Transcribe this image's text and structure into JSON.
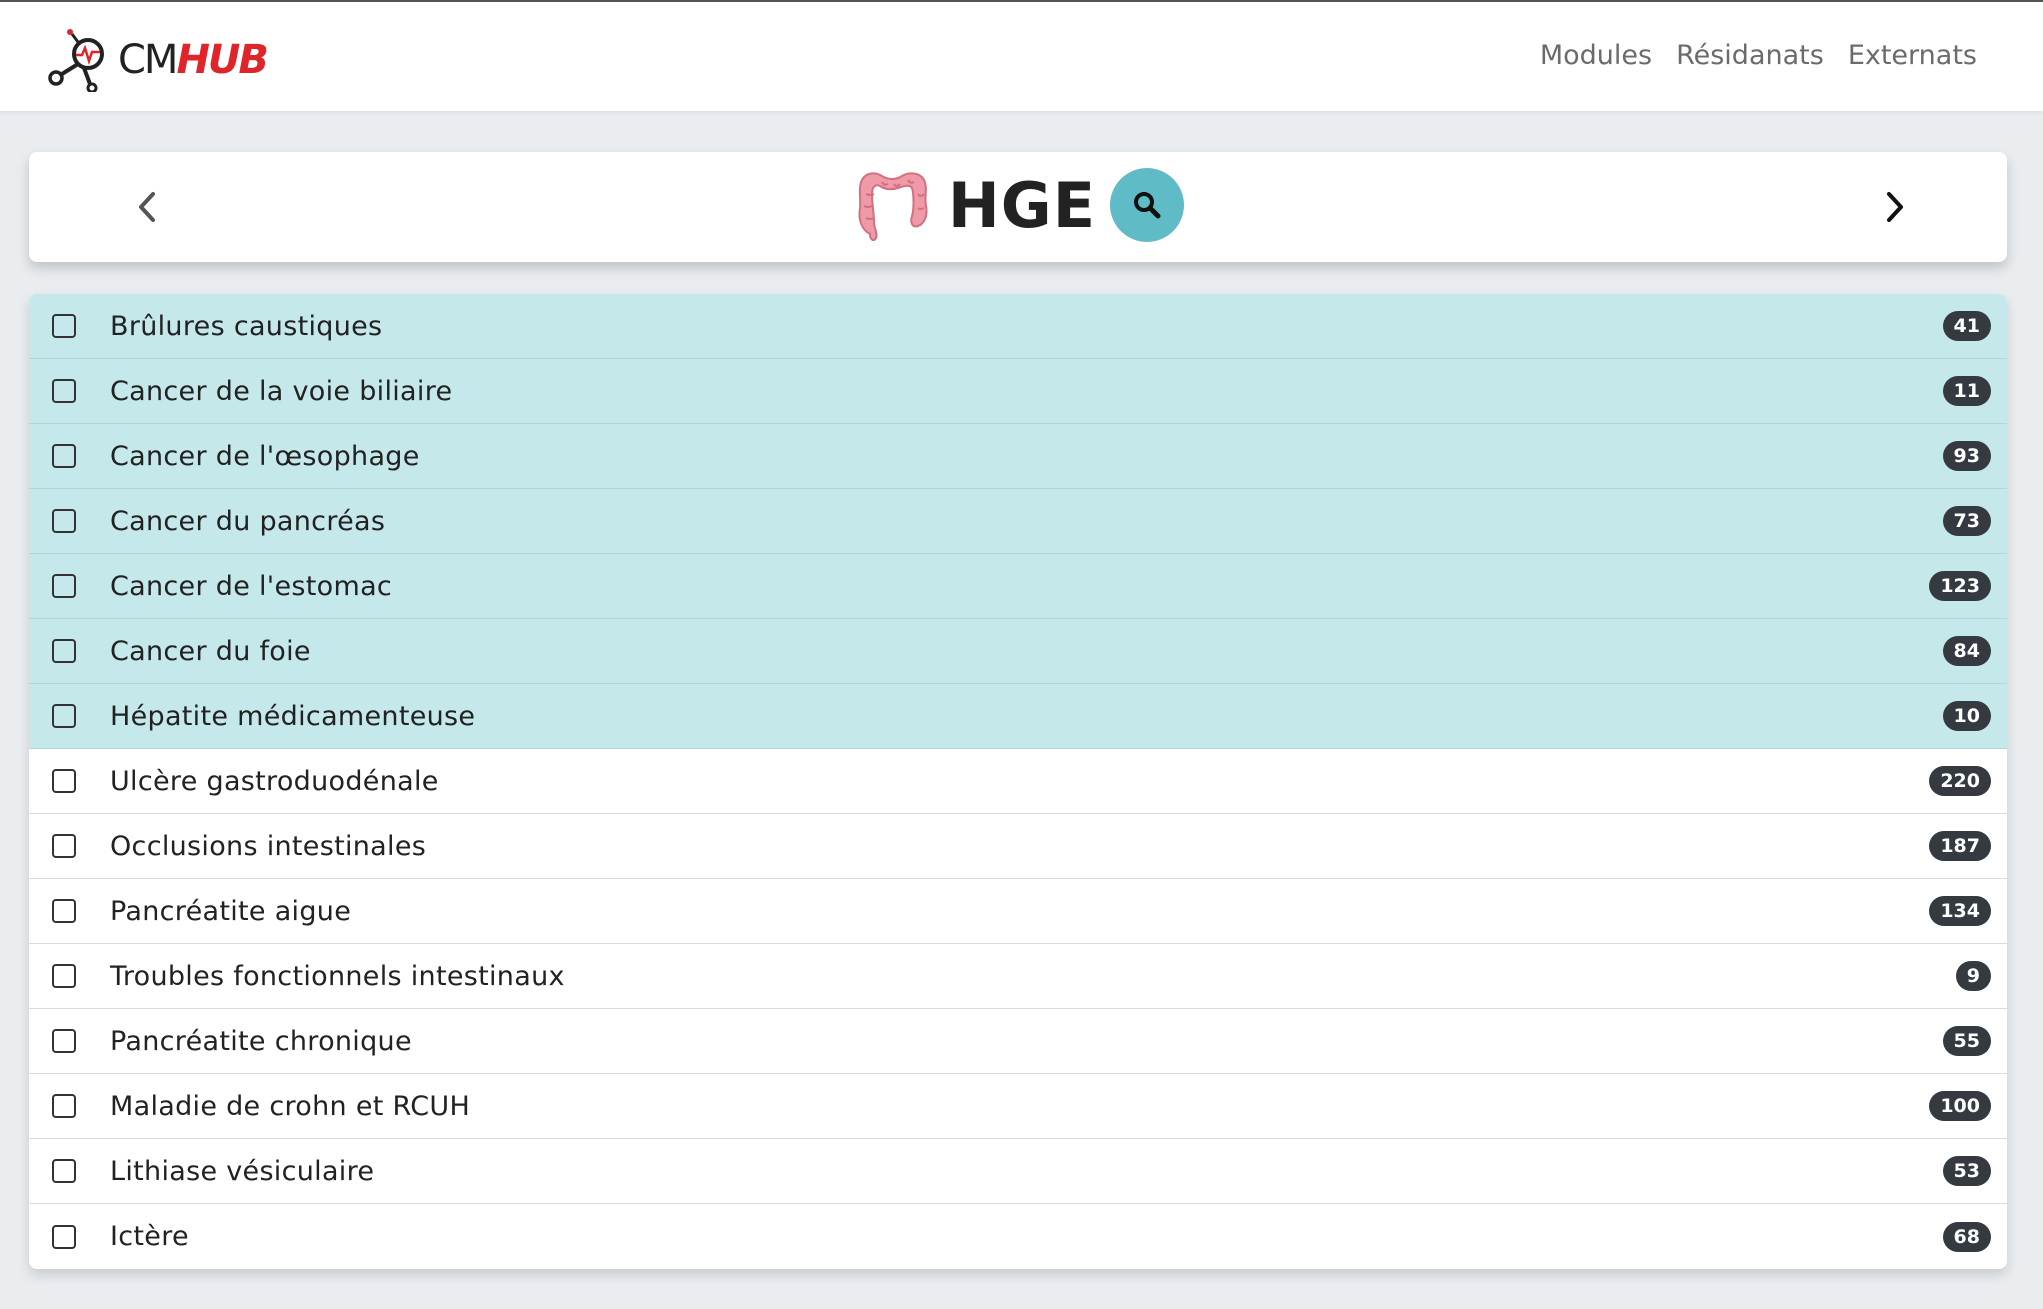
{
  "navbar": {
    "logo_cm": "CM",
    "logo_hub": "HUB",
    "links": [
      "Modules",
      "Résidanats",
      "Externats"
    ]
  },
  "header": {
    "title": "HGE",
    "prev_icon": "chevron-left-icon",
    "next_icon": "chevron-right-icon",
    "search_icon": "search-icon",
    "module_icon": "colon-icon"
  },
  "colors": {
    "accent": "#5fbcc6",
    "highlight_row": "#c5e8ea",
    "badge": "#343a40",
    "brand_red": "#e0252a"
  },
  "items": [
    {
      "label": "Brûlures caustiques",
      "count": "41",
      "highlighted": true
    },
    {
      "label": "Cancer de la voie biliaire",
      "count": "11",
      "highlighted": true
    },
    {
      "label": "Cancer de l'œsophage",
      "count": "93",
      "highlighted": true
    },
    {
      "label": "Cancer du pancréas",
      "count": "73",
      "highlighted": true
    },
    {
      "label": "Cancer de l'estomac",
      "count": "123",
      "highlighted": true
    },
    {
      "label": "Cancer du foie",
      "count": "84",
      "highlighted": true
    },
    {
      "label": "Hépatite médicamenteuse",
      "count": "10",
      "highlighted": true
    },
    {
      "label": "Ulcère gastroduodénale",
      "count": "220",
      "highlighted": false
    },
    {
      "label": "Occlusions intestinales",
      "count": "187",
      "highlighted": false
    },
    {
      "label": "Pancréatite aigue",
      "count": "134",
      "highlighted": false
    },
    {
      "label": "Troubles fonctionnels intestinaux",
      "count": "9",
      "highlighted": false
    },
    {
      "label": "Pancréatite chronique",
      "count": "55",
      "highlighted": false
    },
    {
      "label": "Maladie de crohn et RCUH",
      "count": "100",
      "highlighted": false
    },
    {
      "label": "Lithiase vésiculaire",
      "count": "53",
      "highlighted": false
    },
    {
      "label": "Ictère",
      "count": "68",
      "highlighted": false
    }
  ]
}
